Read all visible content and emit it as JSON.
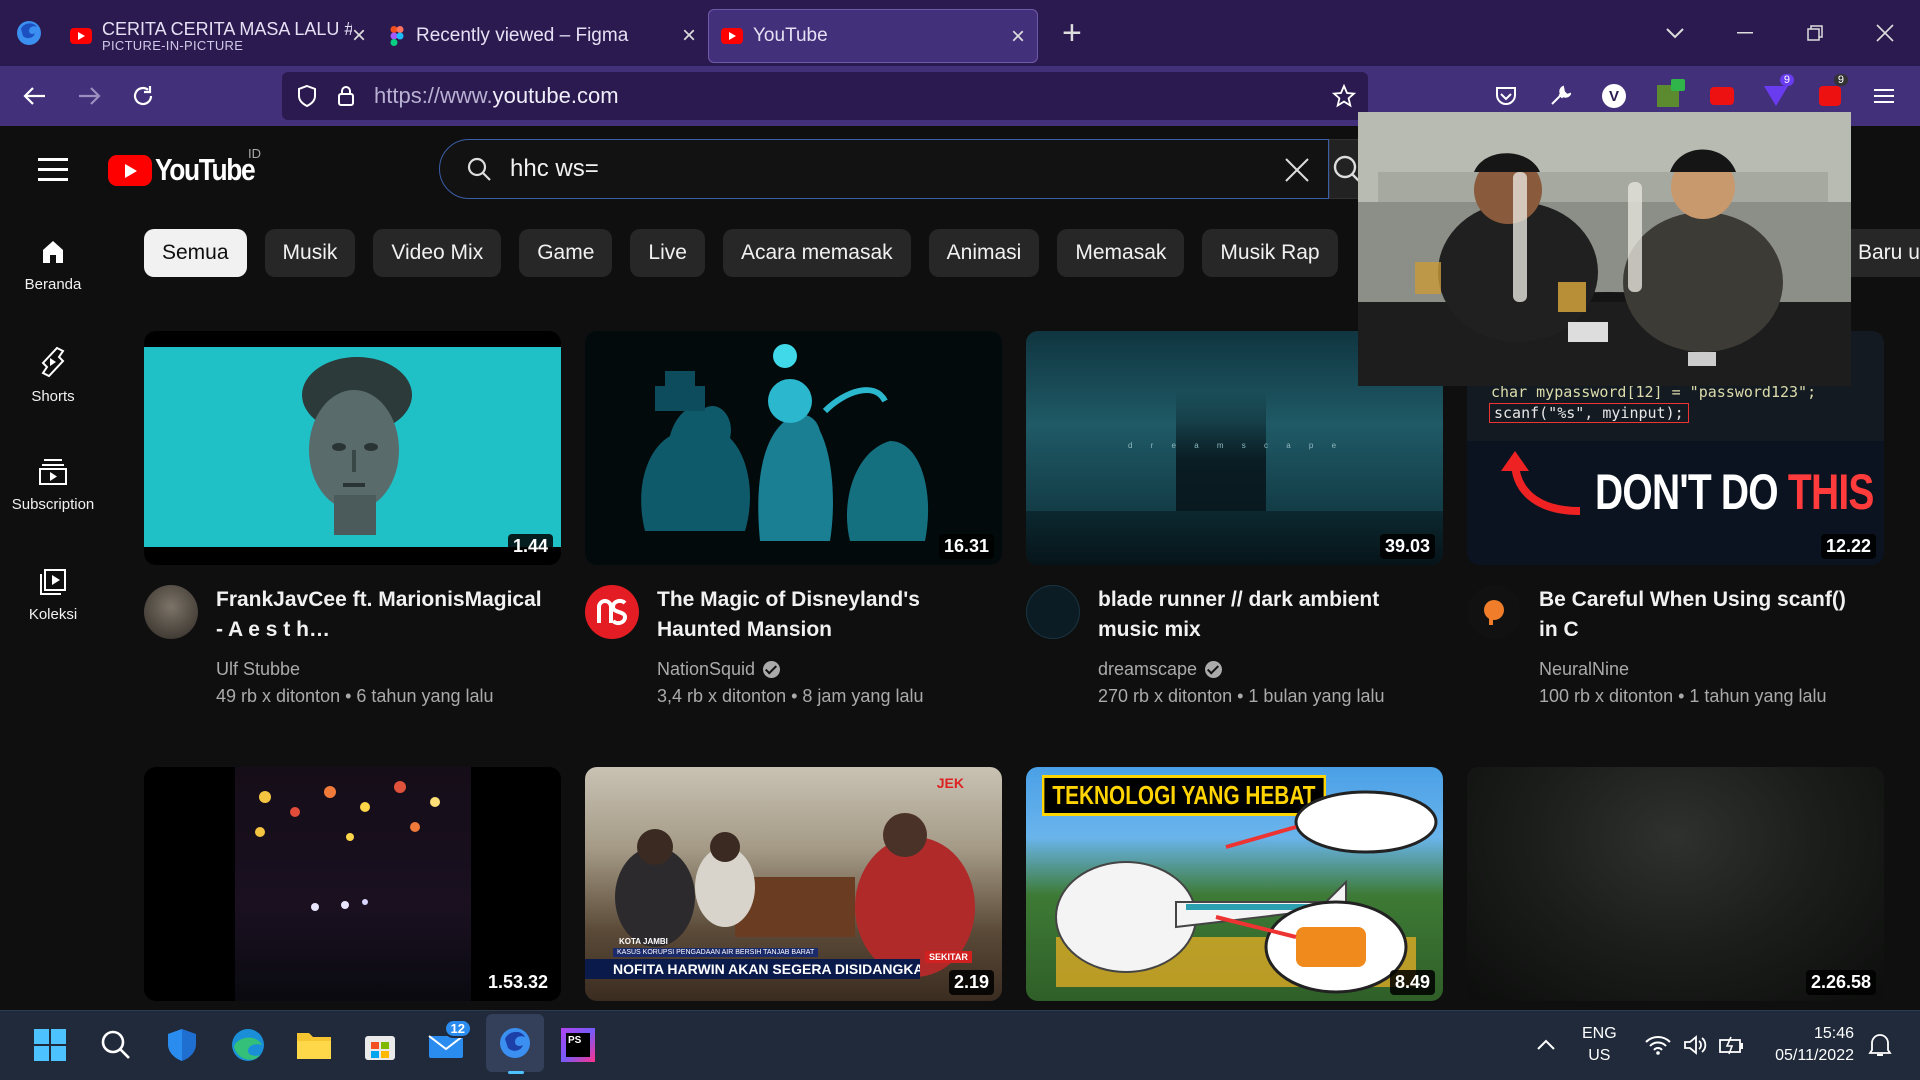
{
  "browser": {
    "tabs": [
      {
        "title": "CERITA CERITA MASA LALU #M",
        "subtitle": "PICTURE-IN-PICTURE",
        "close": "×"
      },
      {
        "title": "Recently viewed – Figma",
        "close": "×"
      },
      {
        "title": "YouTube",
        "close": "×"
      }
    ],
    "new_tab": "+",
    "url_scheme": "https://www.",
    "url_host": "youtube.com",
    "ext_badges": {
      "b1": "9",
      "b2": "9"
    },
    "ext_v": "V"
  },
  "youtube": {
    "logo_text": "YouTube",
    "country": "ID",
    "search_query": "hhc ws=",
    "sidebar": [
      {
        "label": "Beranda",
        "icon": "home-icon"
      },
      {
        "label": "Shorts",
        "icon": "shorts-icon"
      },
      {
        "label": "Subscription",
        "icon": "subscription-icon"
      },
      {
        "label": "Koleksi",
        "icon": "library-icon"
      }
    ],
    "chips": [
      "Semua",
      "Musik",
      "Video Mix",
      "Game",
      "Live",
      "Acara memasak",
      "Animasi",
      "Memasak",
      "Musik Rap"
    ],
    "chip_cut": "Baru u",
    "videos": [
      {
        "title": "FrankJavCee ft. MarionisMagical - A e s t h…",
        "channel": "Ulf Stubbe",
        "verified": false,
        "views": "49 rb x ditonton",
        "age": "6 tahun yang lalu",
        "duration": "1.44"
      },
      {
        "title": "The Magic of Disneyland's Haunted Mansion",
        "channel": "NationSquid",
        "verified": true,
        "views": "3,4 rb x ditonton",
        "age": "8 jam yang lalu",
        "duration": "16.31"
      },
      {
        "title": "blade runner // dark ambient music mix",
        "channel": "dreamscape",
        "verified": true,
        "views": "270 rb x ditonton",
        "age": "1 bulan yang lalu",
        "duration": "39.03",
        "thumb_text": "d r e a m s c a p e"
      },
      {
        "title": "Be Careful When Using scanf() in C",
        "channel": "NeuralNine",
        "verified": false,
        "views": "100 rb x ditonton",
        "age": "1 tahun yang lalu",
        "duration": "12.22",
        "code1": "char mypassword[12] = \"password123\";",
        "code2": "scanf(\"%s\", myinput);",
        "banner_a": "DON'T DO ",
        "banner_b": "THIS"
      },
      {
        "duration": "1.53.32"
      },
      {
        "duration": "2.19",
        "tag": "KOTA JAMBI",
        "sub": "KASUS KORUPSI PENGADAAN AIR BERSIH TANJAB BARAT",
        "headline": "NOFITA HARWIN AKAN SEGERA DISIDANGKAN",
        "corner": "SEKITAR",
        "logo": "JEK"
      },
      {
        "duration": "8.49",
        "banner": "TEKNOLOGI YANG HEBAT"
      },
      {
        "duration": "2.26.58"
      }
    ]
  },
  "taskbar": {
    "mail_badge": "12",
    "lang": "ENG",
    "region": "US",
    "time": "15:46",
    "date": "05/11/2022",
    "ps_label": "PS"
  }
}
